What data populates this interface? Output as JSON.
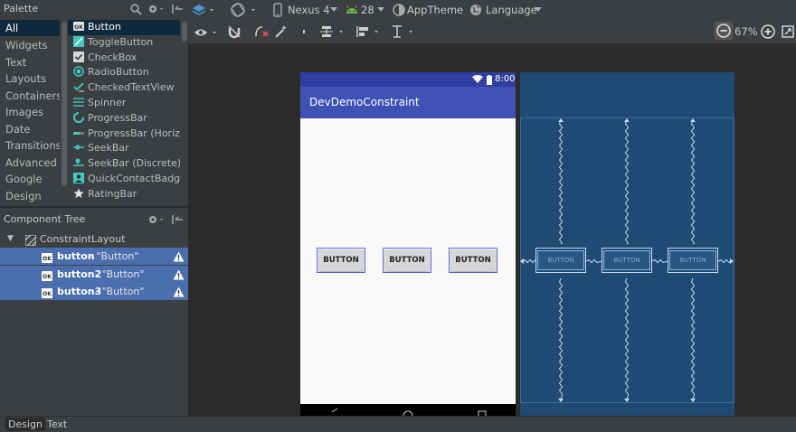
{
  "palette": {
    "title": "Palette",
    "categories": [
      "All",
      "Widgets",
      "Text",
      "Layouts",
      "Containers",
      "Images",
      "Date",
      "Transitions",
      "Advanced",
      "Google",
      "Design"
    ],
    "selected_category": "All",
    "widgets": [
      "Button",
      "ToggleButton",
      "CheckBox",
      "RadioButton",
      "CheckedTextView",
      "Spinner",
      "ProgressBar",
      "ProgressBar (Horizo",
      "SeekBar",
      "SeekBar (Discrete)",
      "QuickContactBadge",
      "RatingBar"
    ],
    "selected_widget": "Button"
  },
  "component_tree": {
    "title": "Component Tree",
    "root": "ConstraintLayout",
    "items": [
      {
        "id": "button",
        "text": " - \"Button\""
      },
      {
        "id": "button2",
        "text": " - \"Button\""
      },
      {
        "id": "button3",
        "text": " - \"Button\""
      }
    ]
  },
  "toolbar": {
    "device": "Nexus 4",
    "api": "28",
    "theme": "AppTheme",
    "language": "Language",
    "zoom": "67%"
  },
  "preview": {
    "status_time": "8:00",
    "app_title": "DevDemoConstraint",
    "buttons": [
      "BUTTON",
      "BUTTON",
      "BUTTON"
    ]
  },
  "blueprint": {
    "buttons": [
      "BUTTON",
      "BUTTON",
      "BUTTON"
    ]
  },
  "bottom_tabs": [
    "Design",
    "Text"
  ],
  "colors": {
    "accent": "#4b6eaf",
    "app_bar": "#3f51b5",
    "blueprint": "#1f4a73",
    "widget_icon": "#43c7c0"
  }
}
